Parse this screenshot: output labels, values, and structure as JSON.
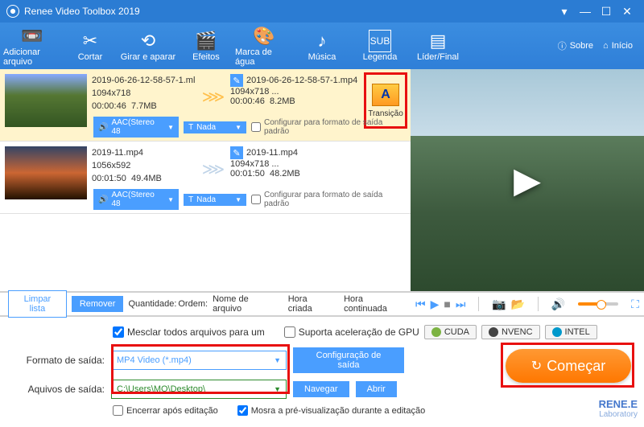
{
  "titlebar": {
    "title": "Renee Video Toolbox 2019"
  },
  "toolbar": {
    "items": [
      {
        "label": "Adicionar arquivo",
        "icon": "📼"
      },
      {
        "label": "Cortar",
        "icon": "✂"
      },
      {
        "label": "Girar e aparar",
        "icon": "⟲"
      },
      {
        "label": "Efeitos",
        "icon": "🎬"
      },
      {
        "label": "Marca de água",
        "icon": "🎨"
      },
      {
        "label": "Música",
        "icon": "♪"
      },
      {
        "label": "Legenda",
        "icon": "SUB"
      },
      {
        "label": "Líder/Final",
        "icon": "▤"
      }
    ],
    "about": "Sobre",
    "home": "Início"
  },
  "rows": [
    {
      "in_name": "2019-06-26-12-58-57-1.ml",
      "in_res": "1094x718",
      "in_time": "00:00:46",
      "in_size": "7.7MB",
      "out_name": "2019-06-26-12-58-57-1.mp4",
      "out_res": "1094x718   ...",
      "out_time": "00:00:46",
      "out_size": "8.2MB",
      "audio": "AAC(Stereo 48",
      "sub": "Nada",
      "chk": "Configurar para formato de saída padrão"
    },
    {
      "in_name": "2019-11.mp4",
      "in_res": "1056x592",
      "in_time": "00:01:50",
      "in_size": "49.4MB",
      "out_name": "2019-11.mp4",
      "out_res": "1094x718   ...",
      "out_time": "00:01:50",
      "out_size": "48.2MB",
      "audio": "AAC(Stereo 48",
      "sub": "Nada",
      "chk": "Configurar para formato de saída padrão"
    }
  ],
  "transition": {
    "label": "Transição"
  },
  "listfooter": {
    "clear": "Limpar lista",
    "remove": "Remover",
    "qty_label": "Quantidade:",
    "order_label": "Ordem:",
    "sort1": "Nome de arquivo",
    "sort2": "Hora criada",
    "sort3": "Hora continuada"
  },
  "bottom": {
    "merge": "Mesclar todos arquivos para um",
    "gpu_label": "Suporta aceleração de GPU",
    "cuda": "CUDA",
    "nvenc": "NVENC",
    "intel": "INTEL",
    "format_label": "Formato de saída:",
    "format_value": "MP4 Video (*.mp4)",
    "path_label": "Aquivos de saída:",
    "path_value": "C:\\Users\\MO\\Desktop\\",
    "config": "Configuração de saída",
    "browse": "Navegar",
    "open": "Abrir",
    "start": "Começar",
    "burn": "Encerrar após editação",
    "preview": "Mosra a pré-visualização durante a editação"
  },
  "brand": {
    "top": "RENE.E",
    "sub": "Laboratory"
  }
}
